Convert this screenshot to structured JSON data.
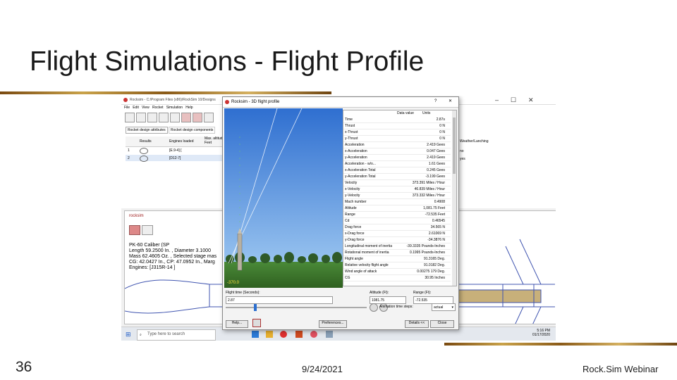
{
  "slide": {
    "title": "Flight Simulations - Flight Profile",
    "number": "36",
    "date": "9/24/2021",
    "footer": "Rock.Sim Webinar"
  },
  "main_window": {
    "title": "Rocksim - C:/Program Files (x86)/RockSim 10/Designs",
    "menu": [
      "File",
      "Edit",
      "View",
      "Rocket",
      "Simulation",
      "Help"
    ],
    "tabs": [
      "Rocket design attributes",
      "Rocket design components"
    ],
    "table_headers": [
      "Results",
      "Engines loaded",
      "Max. altitude Feet"
    ],
    "table_rows": [
      {
        "num": "1",
        "engines": "[E.9-4] ["
      },
      {
        "num": "2",
        "engines": "[D12-7]"
      }
    ],
    "right_header": "Weather/Lanching",
    "right_rows": [
      "no",
      "yes"
    ],
    "window_controls": [
      "–",
      "☐",
      "✕"
    ]
  },
  "rocksim_popup": {
    "tab": "rocksim",
    "info_lines": [
      "PK-60 Caliber (SP",
      "Length 59.2500 In. , Diameter 3.1000",
      "Mass 62.4605 Oz. , Selected stage mas",
      "CG: 42.0427 In., CP: 47.0952 In., Marg",
      "Engines: [J315R-14 ]"
    ]
  },
  "taskbar": {
    "search_placeholder": "Type here to search",
    "time": "5:16 PM",
    "date": "01/17/2020"
  },
  "flight_dialog": {
    "title": "Rocksim - 3D flight profile",
    "help_glyph": "?",
    "close_glyph": "✕",
    "column_headers": [
      "Data value",
      "Units"
    ],
    "altitude_readout": "-370.0",
    "rows": [
      {
        "label": "Time",
        "value": "2.87s"
      },
      {
        "label": "Thrust",
        "value": "0 N"
      },
      {
        "label": "x-Thrust",
        "value": "0 N"
      },
      {
        "label": "y-Thrust",
        "value": "0 N"
      },
      {
        "label": "Acceleration",
        "value": "2.419 Gees"
      },
      {
        "label": "x-Acceleration",
        "value": "0.047 Gees"
      },
      {
        "label": "y-Acceleration",
        "value": "2.419 Gees"
      },
      {
        "label": "Acceleration - w/o...",
        "value": "1.61 Gees"
      },
      {
        "label": "x-Acceleration Total",
        "value": "0.245 Gees"
      },
      {
        "label": "y-Acceleration Total",
        "value": "-3.199 Gees"
      },
      {
        "label": "Velocity",
        "value": "373.391 Miles / Hour"
      },
      {
        "label": "x-Velocity",
        "value": "46.839 Miles / Hour"
      },
      {
        "label": "y-Velocity",
        "value": "373.332 Miles / Hour"
      },
      {
        "label": "Mach number",
        "value": "0.4908"
      },
      {
        "label": "Altitude",
        "value": "1,081.75 Feet"
      },
      {
        "label": "Range",
        "value": "-72.535 Feet"
      },
      {
        "label": "Cd",
        "value": "0.46545"
      },
      {
        "label": "Drag force",
        "value": "34.565 N"
      },
      {
        "label": "x-Drag force",
        "value": "2.61069 N"
      },
      {
        "label": "y-Drag force",
        "value": "-34.3876 N"
      },
      {
        "label": "Longitudinal moment of inertia",
        "value": "-39.3335 Pounds-Inches"
      },
      {
        "label": "Rotational moment of inertia",
        "value": "0.1995 Pounds-Inches"
      },
      {
        "label": "Flight angle",
        "value": "91.3165 Deg."
      },
      {
        "label": "Relative velocity flight angle",
        "value": "91.0182 Deg."
      },
      {
        "label": "Wind angle of attack",
        "value": "0.00275 179 Deg."
      },
      {
        "label": "CG",
        "value": "30.95 Inches"
      }
    ],
    "controls": {
      "flight_time_label": "Flight time (Seconds):",
      "flight_time_value": "2.87",
      "altitude_label": "Altitude (Ft):",
      "altitude_value": "1081.75",
      "range_label": "Range (Ft):",
      "range_value": "-72.535",
      "anim_speed_label": "Animation time steps:",
      "anim_speed_value": "actual",
      "help_button": "Help...",
      "preferences_button": "Preferences...",
      "details_button": "Details <<",
      "close_button": "Close"
    },
    "slider_position": 0.2
  },
  "colors": {
    "sky_top": "#2f6fd0",
    "sky_bottom": "#a8d0f4",
    "grass": "#3f7a2f",
    "accent_gold": "#c9a24a",
    "rocket_body": "#c8b07a"
  }
}
